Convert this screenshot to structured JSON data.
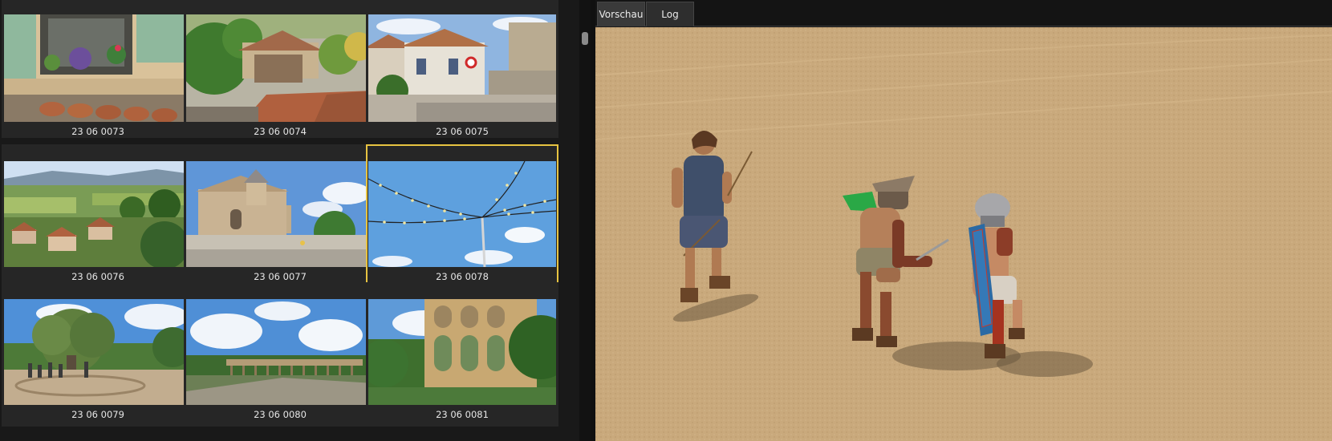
{
  "browser": {
    "thumbnails": [
      {
        "label": "23 06 0073",
        "subject": "window-flowers-thumbnail"
      },
      {
        "label": "23 06 0074",
        "subject": "village-roofs-thumbnail"
      },
      {
        "label": "23 06 0075",
        "subject": "village-street-thumbnail"
      },
      {
        "label": "23 06 0076",
        "subject": "valley-landscape-thumbnail"
      },
      {
        "label": "23 06 0077",
        "subject": "stone-church-thumbnail"
      },
      {
        "label": "23 06 0078",
        "subject": "lights-sky-thumbnail",
        "selected": true
      },
      {
        "label": "23 06 0079",
        "subject": "olive-tree-thumbnail"
      },
      {
        "label": "23 06 0080",
        "subject": "aqueduct-distance-thumbnail"
      },
      {
        "label": "23 06 0081",
        "subject": "aqueduct-close-thumbnail"
      }
    ],
    "selection_color": "#e7c341"
  },
  "preview": {
    "tabs": [
      {
        "label": "Vorschau",
        "active": true
      },
      {
        "label": "Log",
        "active": false
      }
    ],
    "image_subject": "gladiators-arena-preview"
  }
}
